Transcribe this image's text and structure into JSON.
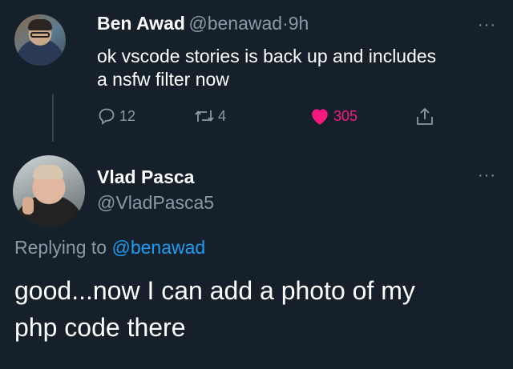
{
  "tweet": {
    "author_name": "Ben Awad",
    "author_handle": "@benawad",
    "separator": "·",
    "time": "9h",
    "text_line1": "ok vscode stories is back up and includes",
    "text_line2": "a nsfw filter now",
    "more": "···",
    "actions": {
      "replies": "12",
      "retweets": "4",
      "likes": "305"
    }
  },
  "reply": {
    "author_name": "Vlad Pasca",
    "author_handle": "@VladPasca5",
    "more": "···",
    "replying_prefix": "Replying to",
    "replying_to": "@benawad",
    "text_line1": "good...now I can add a photo of my",
    "text_line2": "php code there"
  },
  "colors": {
    "background": "#15202b",
    "secondary_text": "#8b98a5",
    "link": "#1d9bf0",
    "like": "#f91880"
  },
  "icons": [
    "reply-icon",
    "retweet-icon",
    "heart-icon",
    "share-icon",
    "more-icon"
  ]
}
